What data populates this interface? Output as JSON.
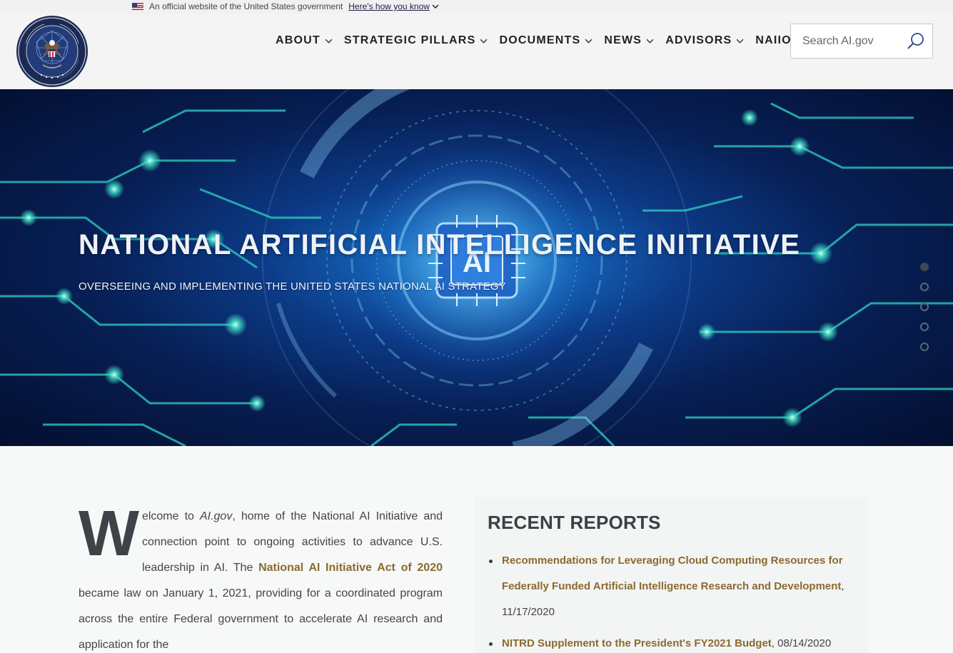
{
  "gov_banner": {
    "text": "An official website of the United States government",
    "link": "Here's how you know"
  },
  "header": {
    "nav": [
      {
        "label": "ABOUT"
      },
      {
        "label": "STRATEGIC PILLARS"
      },
      {
        "label": "DOCUMENTS"
      },
      {
        "label": "NEWS"
      },
      {
        "label": "ADVISORS"
      },
      {
        "label": "NAIIO"
      }
    ],
    "search": {
      "placeholder": "Search AI.gov"
    }
  },
  "hero": {
    "title": "NATIONAL ARTIFICIAL INTELLIGENCE INITIATIVE",
    "subtitle": "OVERSEEING AND IMPLEMENTING THE UNITED STATES NATIONAL AI STRATEGY",
    "chip_text": "AI",
    "slides_count": 5,
    "active_slide": 1
  },
  "welcome": {
    "dropcap": "W",
    "p1": "elcome to ",
    "site_name": "AI.gov",
    "p2": ", home of the National AI Initiative and connection point to ongoing activities to advance U.S. leadership in AI. The ",
    "act_link": "National AI Initiative Act of 2020",
    "p3": " became law on January 1, 2021, providing for a coordinated program across the entire Federal government to accelerate AI research and application for the"
  },
  "reports": {
    "title": "RECENT REPORTS",
    "items": [
      {
        "link": "Recommendations for Leveraging Cloud Computing Resources for Federally Funded Artificial Intelligence Research and Development",
        "date": ", 11/17/2020"
      },
      {
        "link": "NITRD Supplement to the President's FY2021 Budget",
        "date": ", 08/14/2020"
      }
    ]
  },
  "colors": {
    "link": "#8a6b2f",
    "heading": "#3b4046",
    "hero_bg": "#0c3a86",
    "circuit": "#2fd1c0"
  }
}
